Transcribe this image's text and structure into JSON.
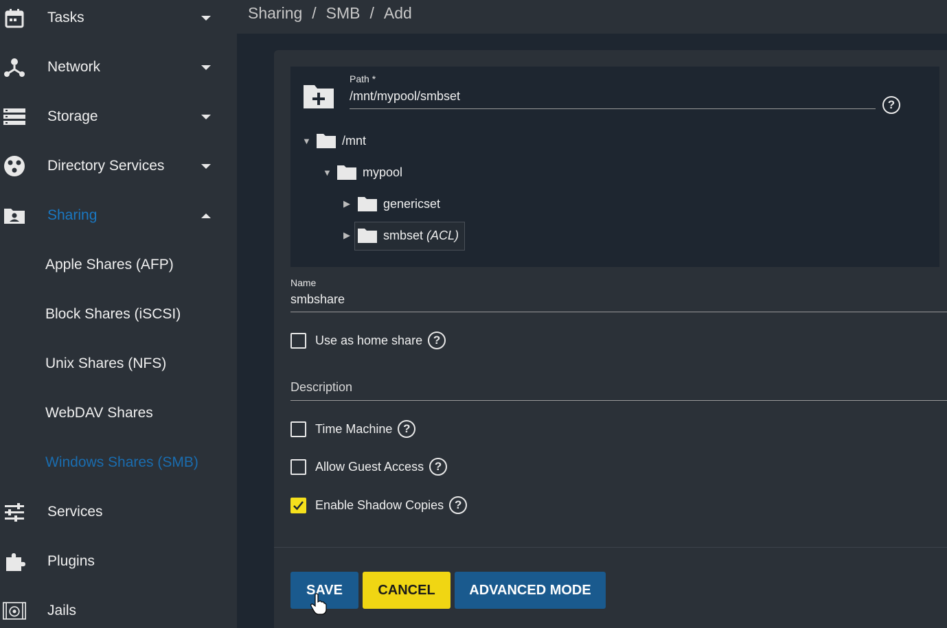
{
  "sidebar": {
    "items": [
      {
        "label": "Tasks",
        "icon": "calendar-icon",
        "expanded": false
      },
      {
        "label": "Network",
        "icon": "network-icon",
        "expanded": false
      },
      {
        "label": "Storage",
        "icon": "storage-icon",
        "expanded": false
      },
      {
        "label": "Directory Services",
        "icon": "directory-services-icon",
        "expanded": false
      },
      {
        "label": "Sharing",
        "icon": "sharing-icon",
        "expanded": true,
        "active": true
      },
      {
        "label": "Services",
        "icon": "services-icon"
      },
      {
        "label": "Plugins",
        "icon": "puzzle-icon"
      },
      {
        "label": "Jails",
        "icon": "jails-icon"
      }
    ],
    "sharing_children": [
      {
        "label": "Apple Shares (AFP)"
      },
      {
        "label": "Block Shares (iSCSI)"
      },
      {
        "label": "Unix Shares (NFS)"
      },
      {
        "label": "WebDAV Shares"
      },
      {
        "label": "Windows Shares (SMB)",
        "active": true
      }
    ]
  },
  "breadcrumb": {
    "items": [
      "Sharing",
      "SMB",
      "Add"
    ],
    "separator": "/"
  },
  "form": {
    "path": {
      "label": "Path *",
      "value": "/mnt/mypool/smbset"
    },
    "tree": [
      {
        "name": "/mnt",
        "expanded": true
      },
      {
        "name": "mypool",
        "expanded": true
      },
      {
        "name": "genericset",
        "expanded": false
      },
      {
        "name": "smbset",
        "suffix": "(ACL)",
        "expanded": false,
        "selected": true
      }
    ],
    "name": {
      "label": "Name",
      "value": "smbshare"
    },
    "home_share": {
      "label": "Use as home share",
      "checked": false
    },
    "description": {
      "label": "Description",
      "value": ""
    },
    "time_machine": {
      "label": "Time Machine",
      "checked": false
    },
    "guest_access": {
      "label": "Allow Guest Access",
      "checked": false
    },
    "shadow_copies": {
      "label": "Enable Shadow Copies",
      "checked": true
    }
  },
  "buttons": {
    "save": "SAVE",
    "cancel": "CANCEL",
    "advanced": "ADVANCED MODE"
  },
  "colors": {
    "accent": "#1a78c2",
    "checkbox_checked": "#f5e01c",
    "primary_button": "#1a5a8e",
    "cancel_button": "#f0d613"
  }
}
